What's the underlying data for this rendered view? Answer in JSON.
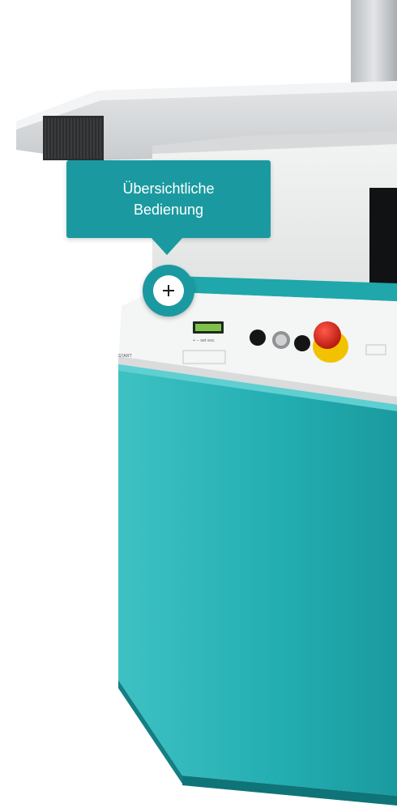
{
  "hotspot": {
    "tooltip_line1": "Übersichtliche",
    "tooltip_line2": "Bedienung",
    "icon": "plus-icon"
  },
  "control_panel": {
    "start_label": "START",
    "display_label": "+ − set esc"
  },
  "colors": {
    "accent": "#1a9aa0",
    "machine_body": "#22b0b4",
    "emergency_stop": "#d9241c",
    "emergency_ring": "#f2c200"
  }
}
